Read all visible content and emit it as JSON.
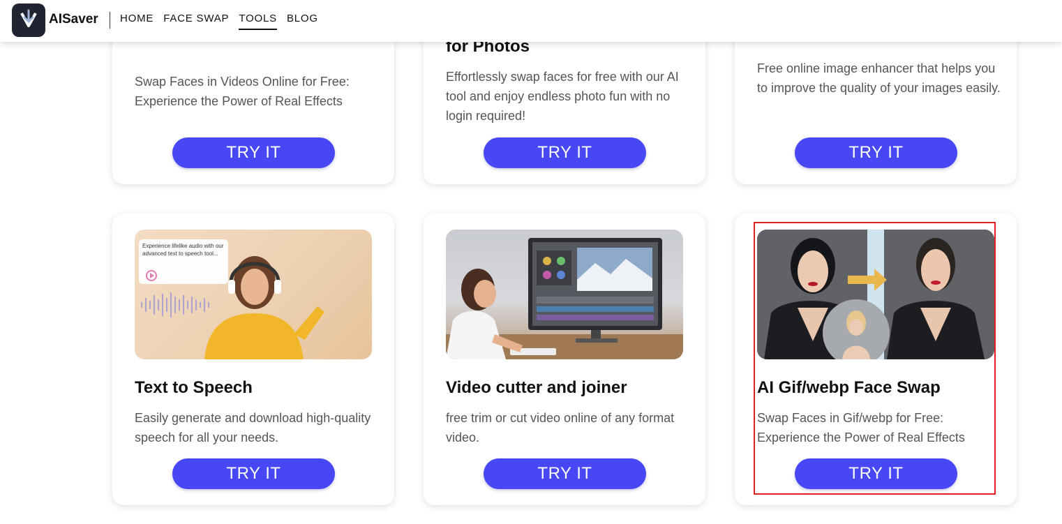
{
  "header": {
    "brand": "AISaver",
    "nav": [
      {
        "label": "HOME",
        "active": false
      },
      {
        "label": "FACE SWAP",
        "active": false
      },
      {
        "label": "TOOLS",
        "active": true
      },
      {
        "label": "BLOG",
        "active": false
      }
    ]
  },
  "cards_top": [
    {
      "title": "",
      "desc": "Swap Faces in Videos Online for Free: Experience the Power of Real Effects",
      "button": "TRY IT"
    },
    {
      "title": "for Photos",
      "desc": "Effortlessly swap faces for free with our AI tool and enjoy endless photo fun with no login required!",
      "button": "TRY IT"
    },
    {
      "title": "",
      "desc": "Free online image enhancer that helps you to improve the quality of your images easily.",
      "button": "TRY IT"
    }
  ],
  "cards_bottom": [
    {
      "title": "Text to Speech",
      "desc": "Easily generate and download high-quality speech for all your needs.",
      "button": "TRY IT",
      "image_caption": "Experience lifelike audio with our advanced text to speech tool..."
    },
    {
      "title": "Video cutter and joiner",
      "desc": "free trim or cut video online of any format video.",
      "button": "TRY IT"
    },
    {
      "title": "AI Gif/webp Face Swap",
      "desc": "Swap Faces in Gif/webp for Free: Experience the Power of Real Effects",
      "button": "TRY IT"
    }
  ],
  "colors": {
    "button": "#4747f5",
    "highlight": "#e02020"
  }
}
